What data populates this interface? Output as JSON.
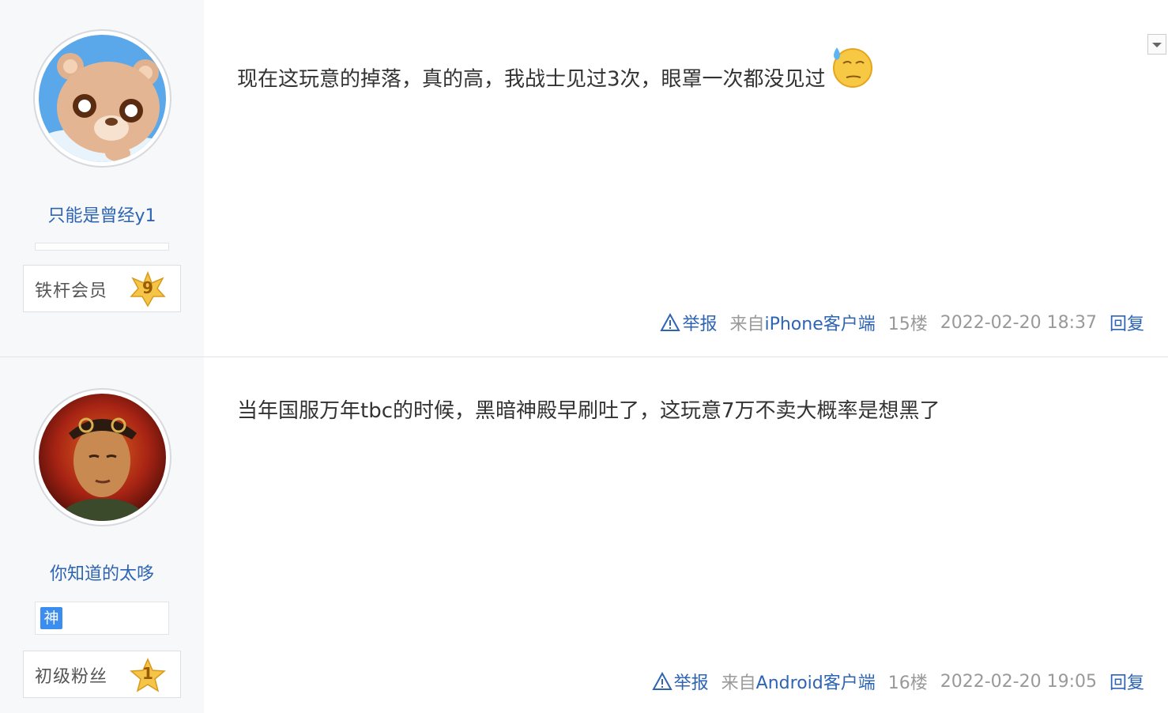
{
  "posts": [
    {
      "username": "只能是曾经y1",
      "level_name": "铁杆会员",
      "level_number": "9",
      "content": "现在这玩意的掉落，真的高，我战士见过3次，眼罩一次都没见过",
      "report_label": "举报",
      "source_prefix": "来自",
      "source_client": "iPhone客户端",
      "floor": "15楼",
      "time": "2022-02-20 18:37",
      "reply_label": "回复"
    },
    {
      "username": "你知道的太哆",
      "badge": "神",
      "level_name": "初级粉丝",
      "level_number": "1",
      "content": "当年国服万年tbc的时候，黑暗神殿早刷吐了，这玩意7万不卖大概率是想黑了",
      "report_label": "举报",
      "source_prefix": "来自",
      "source_client": "Android客户端",
      "floor": "16楼",
      "time": "2022-02-20 19:05",
      "reply_label": "回复"
    }
  ],
  "colors": {
    "link": "#2d64b3",
    "meta": "#999999",
    "sidebar": "#f7f8fa",
    "badge": "#3b8ef0"
  }
}
